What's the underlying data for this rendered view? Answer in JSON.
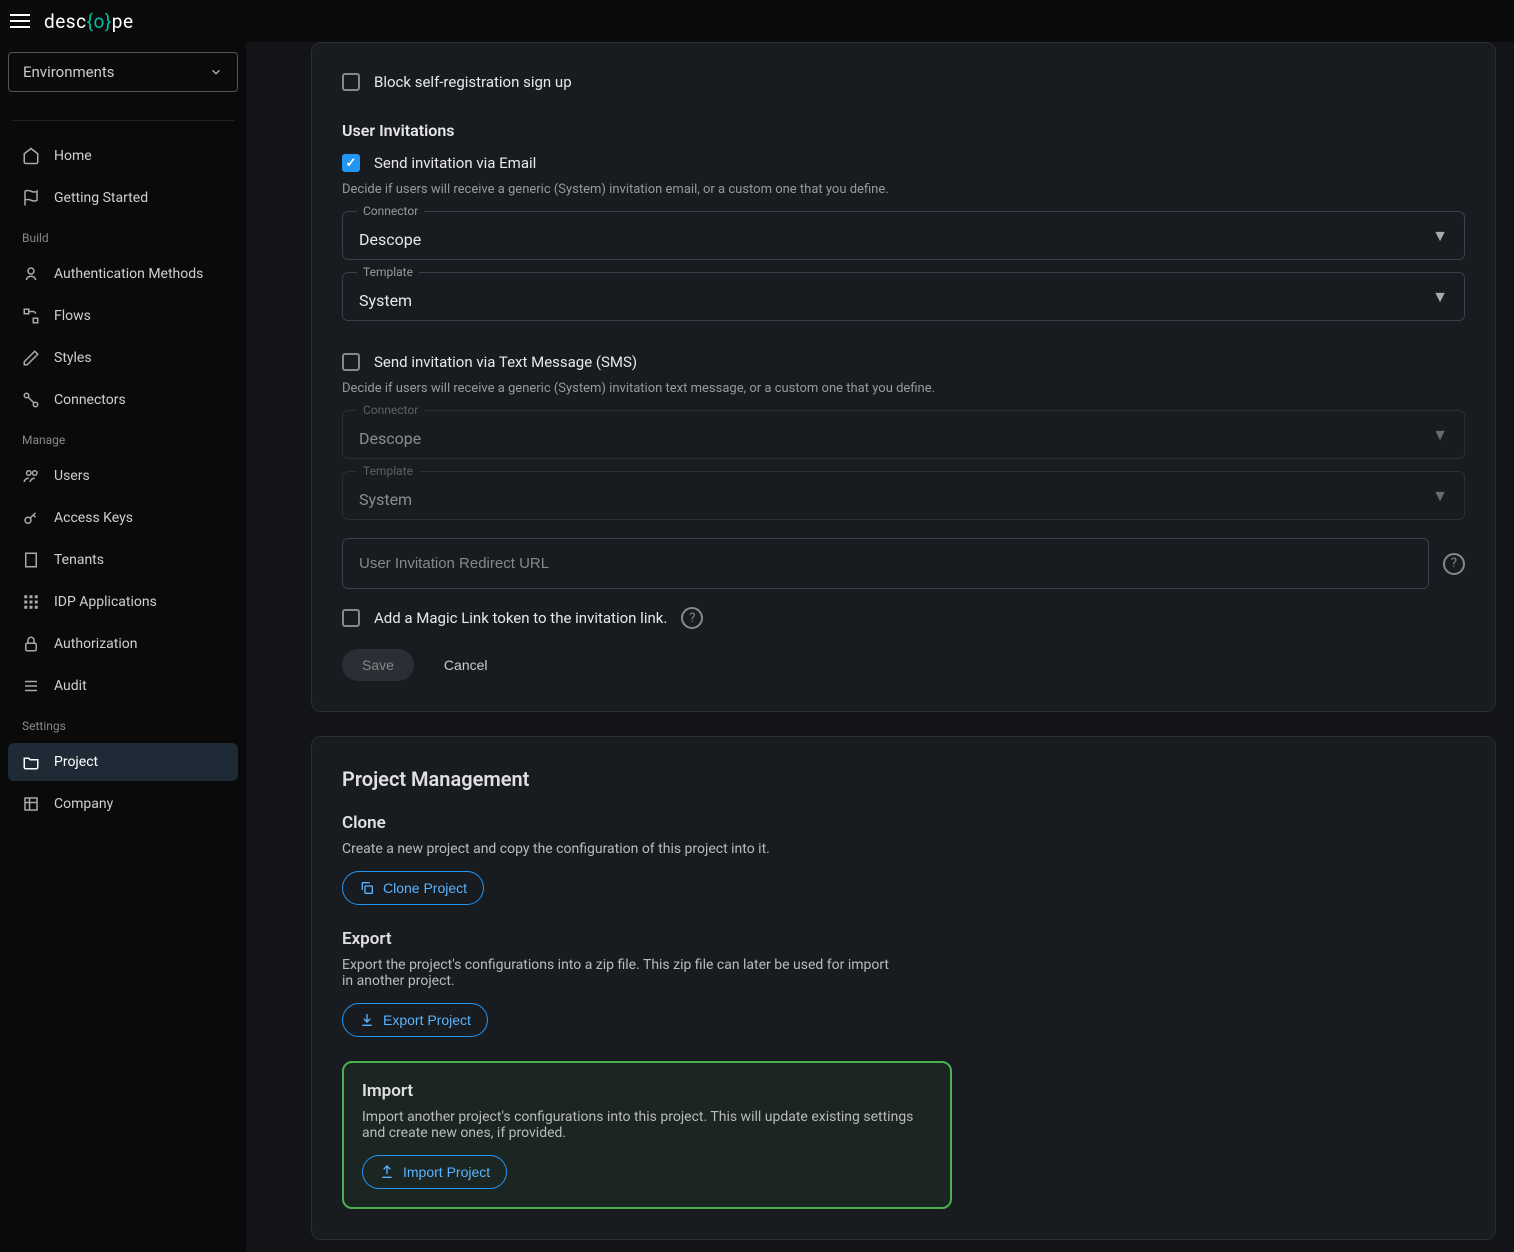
{
  "logo": {
    "pre": "de",
    "mid1": "sc",
    "mid2": "o",
    "mid3": "pe"
  },
  "env": {
    "label": "Environments"
  },
  "side": {
    "home": "Home",
    "getting_started": "Getting Started",
    "build_header": "Build",
    "auth_methods": "Authentication Methods",
    "flows": "Flows",
    "styles": "Styles",
    "connectors": "Connectors",
    "manage_header": "Manage",
    "users": "Users",
    "access_keys": "Access Keys",
    "tenants": "Tenants",
    "idp_apps": "IDP Applications",
    "authorization": "Authorization",
    "audit": "Audit",
    "settings_header": "Settings",
    "project": "Project",
    "company": "Company"
  },
  "settings": {
    "block_self_reg": "Block self-registration sign up",
    "user_invites_heading": "User Invitations",
    "email_label": "Send invitation via Email",
    "email_desc": "Decide if users will receive a generic (System) invitation email, or a custom one that you define.",
    "connector_label": "Connector",
    "connector_value": "Descope",
    "template_label": "Template",
    "template_value": "System",
    "sms_label": "Send invitation via Text Message (SMS)",
    "sms_desc": "Decide if users will receive a generic (System) invitation text message, or a custom one that you define.",
    "sms_connector_value": "Descope",
    "sms_template_value": "System",
    "redirect_placeholder": "User Invitation Redirect URL",
    "magic_link_label": "Add a Magic Link token to the invitation link.",
    "save": "Save",
    "cancel": "Cancel"
  },
  "pm": {
    "heading": "Project Management",
    "clone_heading": "Clone",
    "clone_desc": "Create a new project and copy the configuration of this project into it.",
    "clone_btn": "Clone Project",
    "export_heading": "Export",
    "export_desc": "Export the project's configurations into a zip file. This zip file can later be used for import in another project.",
    "export_btn": "Export Project",
    "import_heading": "Import",
    "import_desc": "Import another project's configurations into this project. This will update existing settings and create new ones, if provided.",
    "import_btn": "Import Project"
  }
}
